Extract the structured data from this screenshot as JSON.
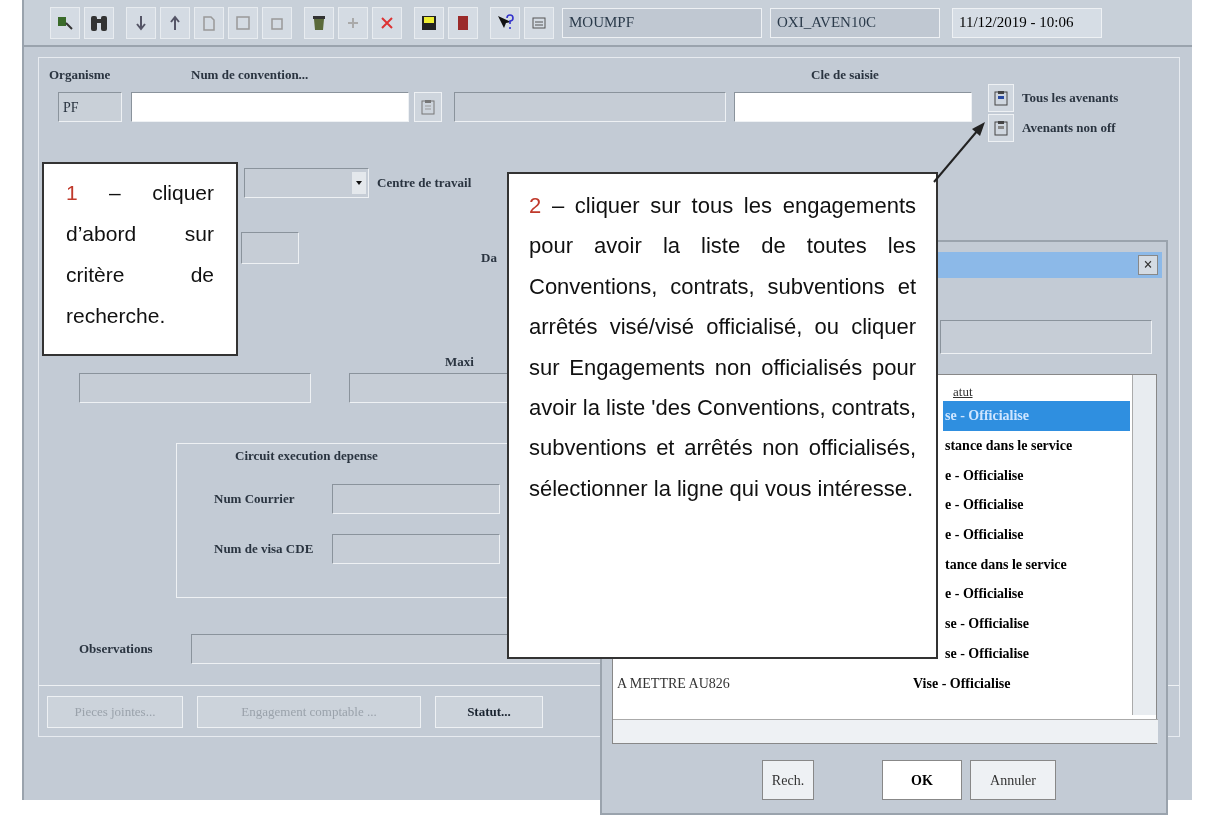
{
  "toolbar": {
    "fields": [
      "MOUMPF",
      "OXI_AVEN10C",
      "11/12/2019 - 10:06"
    ]
  },
  "form": {
    "organisme_label": "Organisme",
    "organisme_value": "PF",
    "convention_label": "Num de convention...",
    "cle_label": "Cle de saisie",
    "options": [
      "Tous les avenants",
      "Avenants non off"
    ],
    "centre_label": "Centre de travail",
    "date_label": "Da",
    "maxi_label": "Maxi",
    "circuit": {
      "title": "Circuit execution depense",
      "fields": [
        "Num Courrier",
        "Num de visa CDE"
      ]
    },
    "observations_label": "Observations"
  },
  "buttons": [
    {
      "label": "Pieces jointes...",
      "disabled": true
    },
    {
      "label": "Engagement comptable ...",
      "disabled": true
    },
    {
      "label": "Statut...",
      "disabled": false
    }
  ],
  "dialog": {
    "close": "×",
    "column_header": "atut",
    "rows": [
      {
        "name": "",
        "statut": "se - Officialise",
        "selected": true
      },
      {
        "name": "",
        "statut": "stance dans le service",
        "selected": false
      },
      {
        "name": "",
        "statut": "e - Officialise",
        "selected": false
      },
      {
        "name": "",
        "statut": "e - Officialise",
        "selected": false
      },
      {
        "name": "",
        "statut": "e - Officialise",
        "selected": false
      },
      {
        "name": "",
        "statut": "tance dans le service",
        "selected": false
      },
      {
        "name": "",
        "statut": "e - Officialise",
        "selected": false
      },
      {
        "name": "",
        "statut": "se - Officialise",
        "selected": false
      },
      {
        "name": "",
        "statut": "se - Officialise",
        "selected": false
      },
      {
        "name": "A METTRE AU826",
        "statut": "Vise - Officialise",
        "selected": false
      }
    ],
    "buttons": [
      "Rech.",
      "OK",
      "Annuler"
    ]
  },
  "callouts": [
    {
      "number": "1",
      "text": "– cliquer d’abord sur critère de recherche."
    },
    {
      "number": "2",
      "text": "– cliquer sur tous les engagements pour avoir la liste de toutes les Conventions, contrats, subventions et arrêtés visé/visé officialisé, ou cliquer sur Engagements non officialisés pour avoir la liste 'des Conventions, contrats, subventions et arrêtés non officialisés, sélectionner la ligne qui vous intéresse."
    }
  ]
}
